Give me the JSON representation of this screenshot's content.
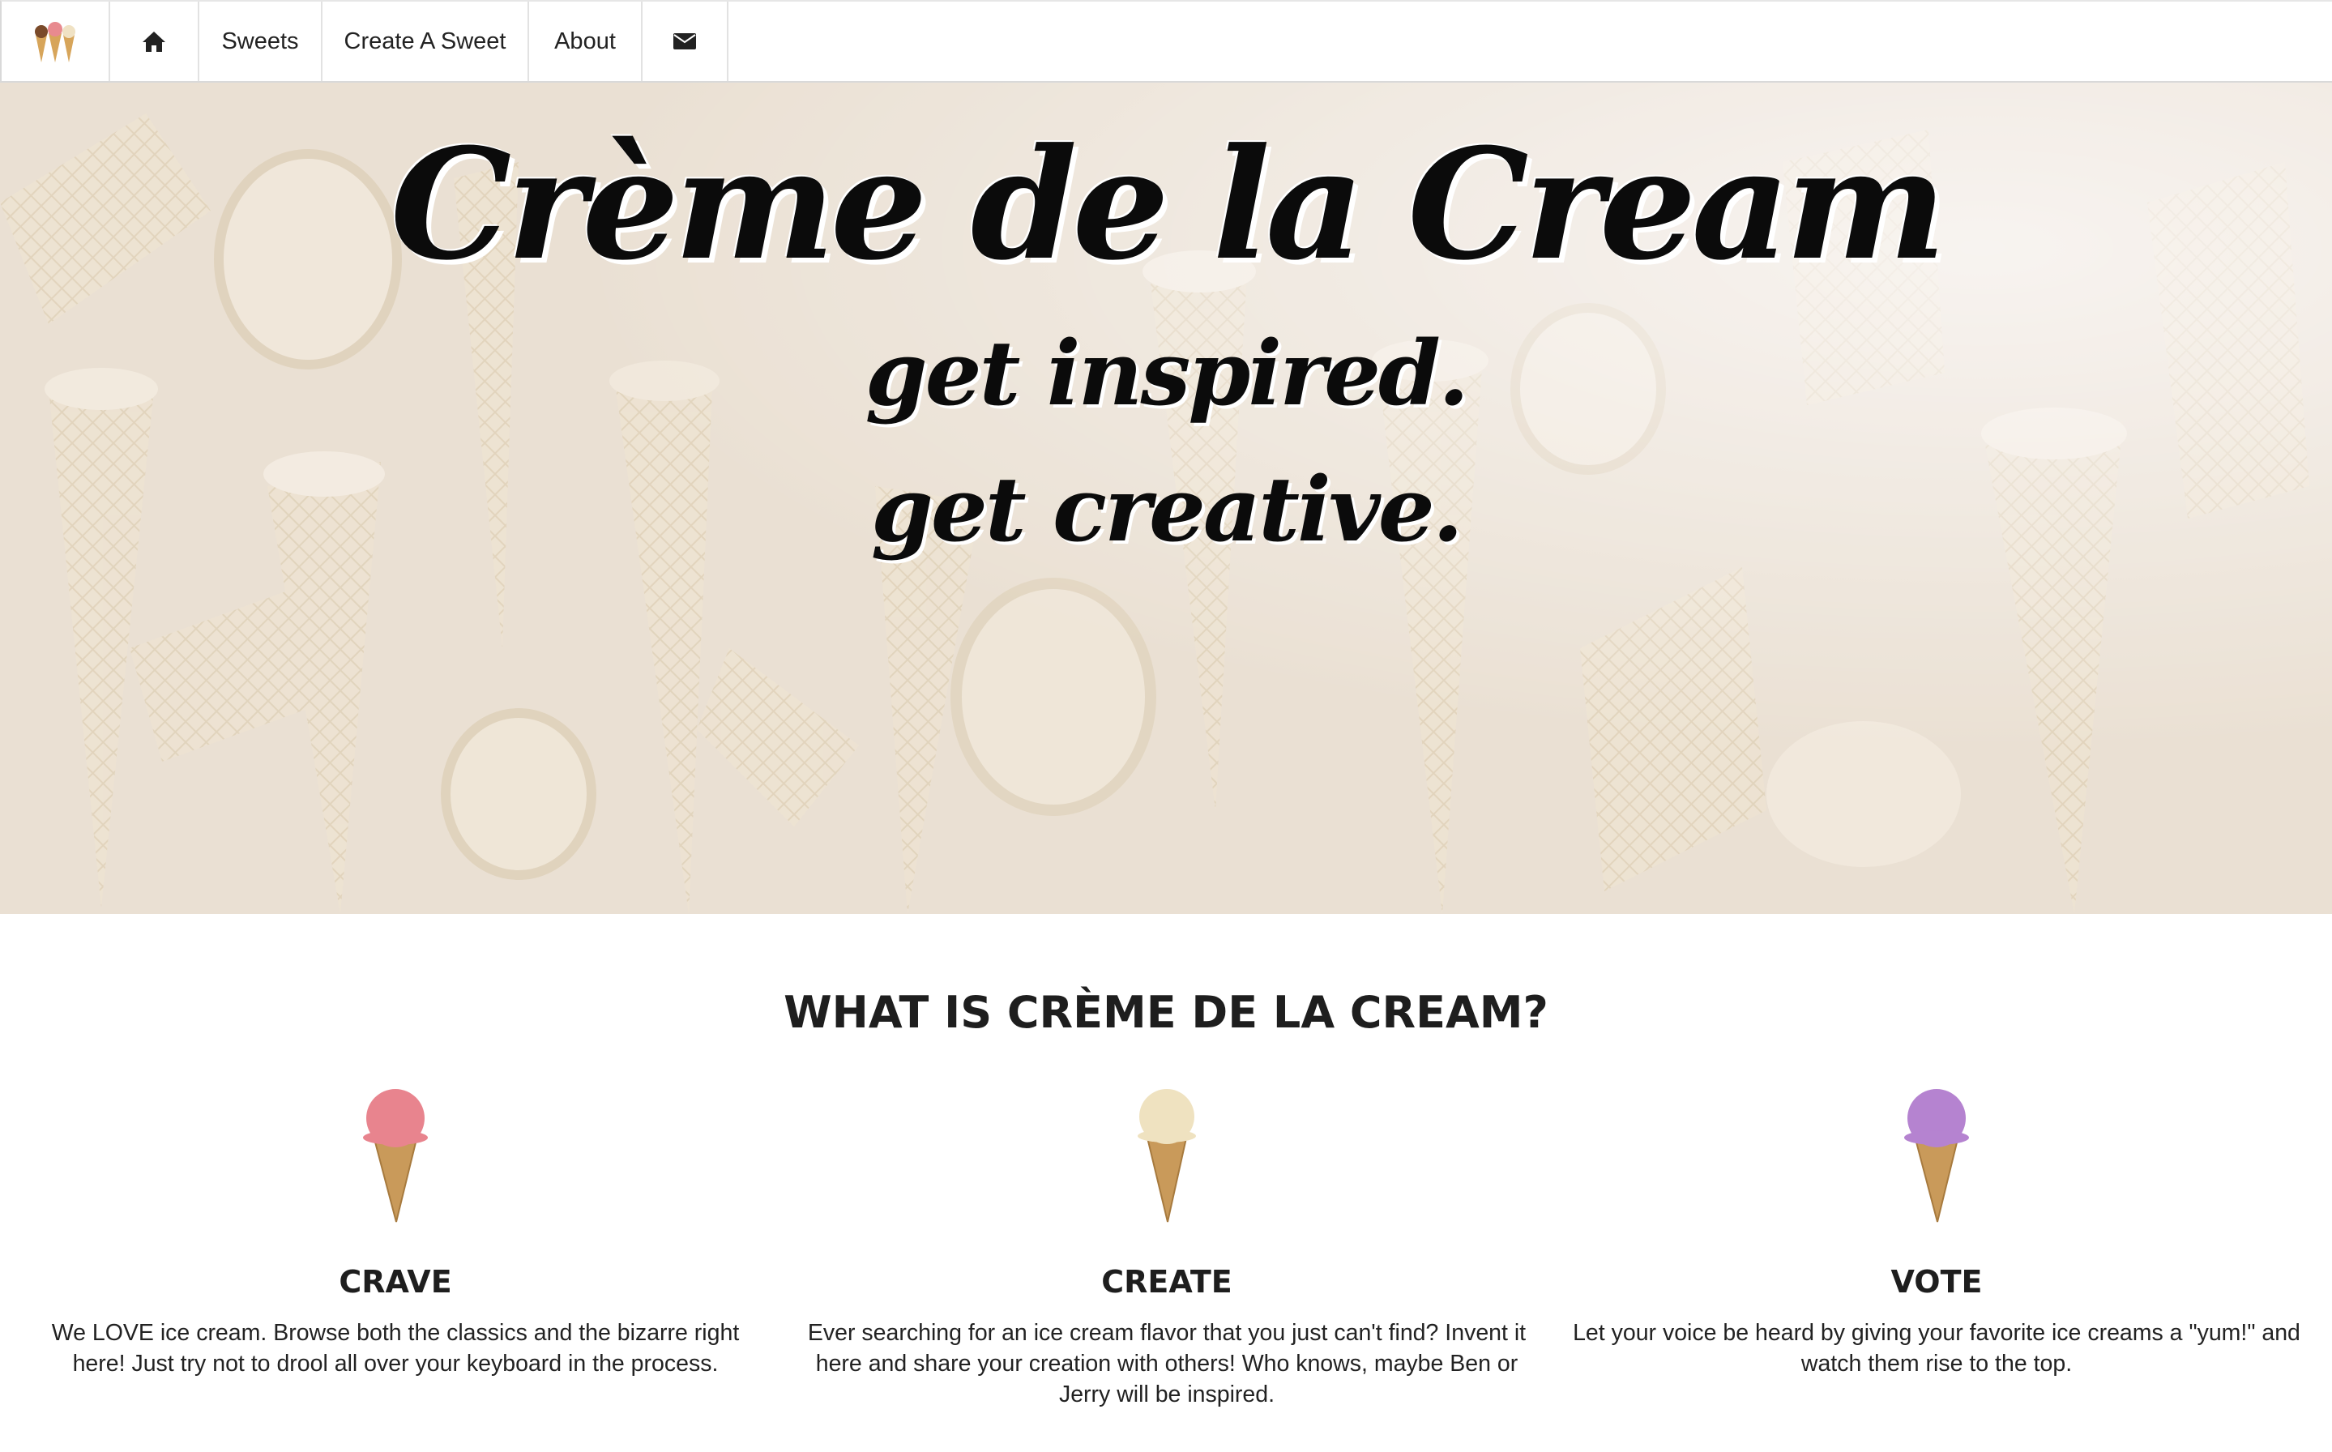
{
  "nav": {
    "logo_icon": "ice-cream-cones-logo",
    "home_icon": "home-icon",
    "items": [
      {
        "label": "Sweets"
      },
      {
        "label": "Create A Sweet"
      },
      {
        "label": "About"
      }
    ],
    "mail_icon": "envelope-icon"
  },
  "hero": {
    "title": "Crème de la Cream",
    "subtitle_1": "get inspired.",
    "subtitle_2": "get creative."
  },
  "about": {
    "heading": "WHAT IS CRÈME DE LA CREAM?",
    "features": [
      {
        "title": "CRAVE",
        "text": "We LOVE ice cream. Browse both the classics and the bizarre right here! Just try not to drool all over your keyboard in the process.",
        "scoop_color": "#e8848e"
      },
      {
        "title": "CREATE",
        "text": "Ever searching for an ice cream flavor that you just can't find? Invent it here and share your creation with others! Who knows, maybe Ben or Jerry will be inspired.",
        "scoop_color": "#efe2c0"
      },
      {
        "title": "VOTE",
        "text": "Let your voice be heard by giving your favorite ice creams a \"yum!\" and watch them rise to the top.",
        "scoop_color": "#b583d0"
      }
    ]
  }
}
